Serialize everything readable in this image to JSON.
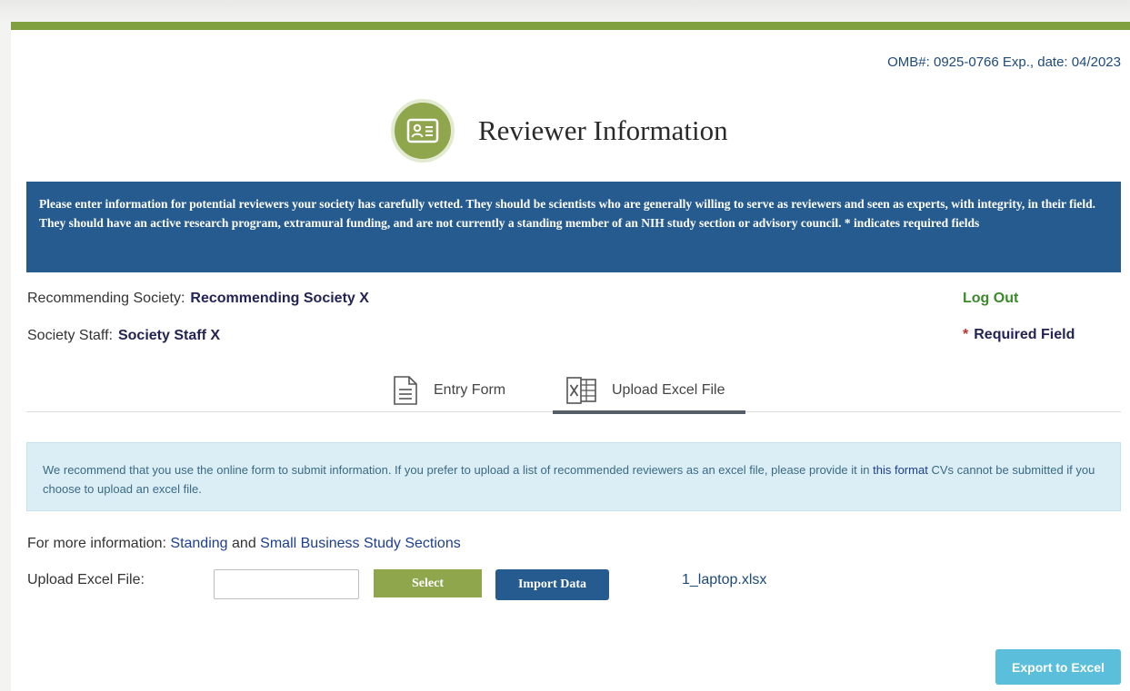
{
  "header": {
    "omb": "OMB#: 0925-0766 Exp., date: 04/2023",
    "title": "Reviewer Information",
    "title_icon": "id-card-icon"
  },
  "banner": {
    "text": "Please enter information for potential reviewers your society has carefully vetted. They should be scientists who are generally willing to serve as reviewers and seen as experts, with integrity, in their field. They should have an active research program, extramural funding, and are not currently a standing member of an NIH study section or advisory council. * indicates required fields"
  },
  "society": {
    "label": "Recommending Society:",
    "value": "Recommending Society X"
  },
  "staff": {
    "label": "Society Staff:",
    "value": "Society Staff X"
  },
  "logout": "Log Out",
  "required": {
    "star": "*",
    "label": "Required Field"
  },
  "tabs": [
    {
      "label": "Entry Form",
      "icon": "document-icon",
      "active": false
    },
    {
      "label": "Upload Excel File",
      "icon": "excel-file-icon",
      "active": true
    }
  ],
  "note": {
    "text_before": "We recommend that you use the online form to submit information. If you prefer to upload a list of recommended reviewers as an excel file, please provide it in",
    "link": "this format",
    "text_after": "CVs cannot be submitted if you choose to upload an excel file."
  },
  "more_info": {
    "prefix": "For more information:",
    "link1": "Standing",
    "conj": "and",
    "link2": "Small Business Study Sections"
  },
  "upload": {
    "label": "Upload Excel File:",
    "input_value": "",
    "select_label": "Select",
    "import_label": "Import Data",
    "file_name": "1_laptop.xlsx"
  },
  "export_label": "Export to Excel",
  "colors": {
    "green_accent": "#80a03f",
    "banner_blue": "#255b8e",
    "note_bg": "#dbeef6",
    "export_btn": "#5bbfdc"
  }
}
